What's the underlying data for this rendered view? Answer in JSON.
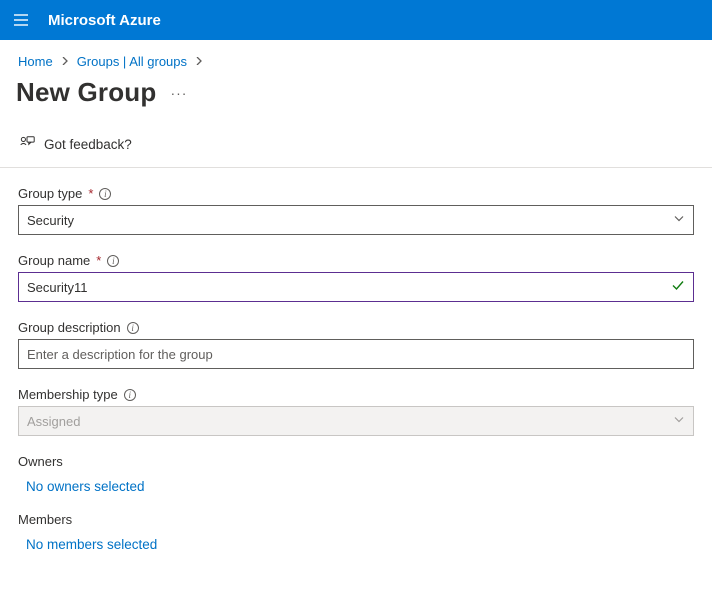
{
  "header": {
    "brand": "Microsoft Azure"
  },
  "breadcrumbs": {
    "items": [
      "Home",
      "Groups | All groups"
    ]
  },
  "page": {
    "title": "New Group"
  },
  "feedback": {
    "label": "Got feedback?"
  },
  "form": {
    "group_type": {
      "label": "Group type",
      "value": "Security"
    },
    "group_name": {
      "label": "Group name",
      "value": "Security11"
    },
    "group_description": {
      "label": "Group description",
      "placeholder": "Enter a description for the group",
      "value": ""
    },
    "membership_type": {
      "label": "Membership type",
      "value": "Assigned"
    },
    "owners": {
      "heading": "Owners",
      "link": "No owners selected"
    },
    "members": {
      "heading": "Members",
      "link": "No members selected"
    }
  }
}
